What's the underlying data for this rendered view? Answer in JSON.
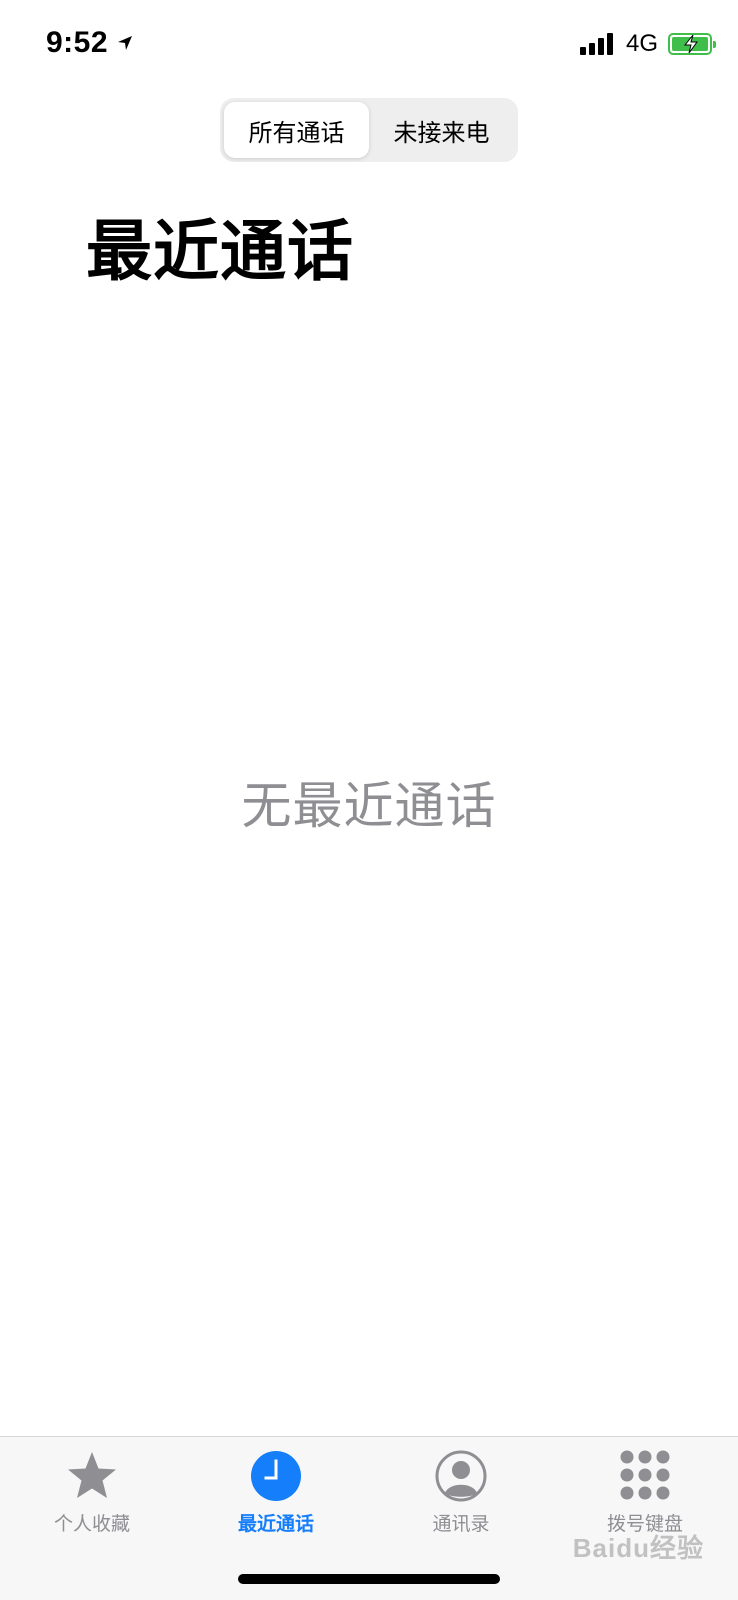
{
  "status_bar": {
    "time": "9:52",
    "network": "4G",
    "icons": [
      "location-arrow-icon",
      "cellular-signal-icon",
      "battery-charging-icon"
    ]
  },
  "segmented_control": {
    "segments": [
      {
        "label": "所有通话",
        "selected": true
      },
      {
        "label": "未接来电",
        "selected": false
      }
    ]
  },
  "header": {
    "title": "最近通话"
  },
  "empty_state": {
    "message": "无最近通话"
  },
  "tab_bar": {
    "items": [
      {
        "label": "个人收藏",
        "icon": "star-icon",
        "active": false
      },
      {
        "label": "最近通话",
        "icon": "clock-icon",
        "active": true
      },
      {
        "label": "通讯录",
        "icon": "contact-icon",
        "active": false
      },
      {
        "label": "拨号键盘",
        "icon": "keypad-icon",
        "active": false
      }
    ]
  },
  "watermark": {
    "text": "Baidu经验"
  },
  "colors": {
    "accent": "#157efb",
    "inactive": "#8e8e93",
    "battery": "#3fbf4a",
    "segment_bg": "#eeeeef"
  }
}
